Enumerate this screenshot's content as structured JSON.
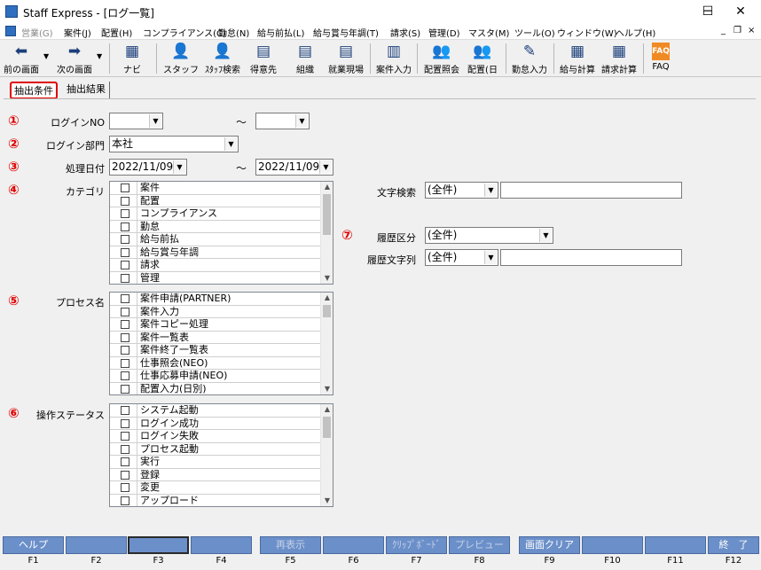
{
  "window": {
    "title": "Staff Express - [ログ一覧]",
    "min": "─",
    "max": "☐",
    "close": "✕"
  },
  "menu": [
    {
      "label": "営業(G)",
      "disabled": true
    },
    {
      "label": "案件(J)"
    },
    {
      "label": "配置(H)"
    },
    {
      "label": "コンプライアンス(C)"
    },
    {
      "label": "勤怠(N)"
    },
    {
      "label": "給与前払(L)"
    },
    {
      "label": "給与賞与年調(T)"
    },
    {
      "label": "請求(S)"
    },
    {
      "label": "管理(D)"
    },
    {
      "label": "マスタ(M)"
    },
    {
      "label": "ツール(O)"
    },
    {
      "label": "ウィンドウ(W)"
    },
    {
      "label": "ヘルプ(H)"
    }
  ],
  "mdi_buttons": {
    "min": "_",
    "restore": "❐",
    "close": "×"
  },
  "toolbar": [
    {
      "label": "前の画面",
      "icon": "back-arrow-icon"
    },
    {
      "label": "次の画面",
      "icon": "forward-arrow-icon"
    },
    {
      "label": "ナビ",
      "icon": "navi-icon"
    },
    {
      "label": "スタッフ",
      "icon": "staff-icon"
    },
    {
      "label": "ｽﾀｯﾌ検索",
      "icon": "staff-search-icon"
    },
    {
      "label": "得意先",
      "icon": "customer-icon"
    },
    {
      "label": "組織",
      "icon": "organization-icon"
    },
    {
      "label": "就業現場",
      "icon": "worksite-icon"
    },
    {
      "label": "案件入力",
      "icon": "job-entry-icon"
    },
    {
      "label": "配置照会",
      "icon": "assignment-inquiry-icon"
    },
    {
      "label": "配置(日",
      "icon": "assignment-daily-icon"
    },
    {
      "label": "勤怠入力",
      "icon": "attendance-entry-icon"
    },
    {
      "label": "給与計算",
      "icon": "payroll-calc-icon"
    },
    {
      "label": "請求計算",
      "icon": "billing-calc-icon"
    },
    {
      "label": "FAQ",
      "icon": "faq-icon"
    }
  ],
  "tabs": [
    {
      "label": "抽出条件",
      "active": true
    },
    {
      "label": "抽出結果",
      "active": false
    }
  ],
  "markers": {
    "m1": "①",
    "m2": "②",
    "m3": "③",
    "m4": "④",
    "m5": "⑤",
    "m6": "⑥",
    "m7": "⑦"
  },
  "form": {
    "login_no_label": "ログインNO",
    "login_no_from": "",
    "tilde": "～",
    "login_no_to": "",
    "dept_label": "ログイン部門",
    "dept_value": "本社",
    "date_label": "処理日付",
    "date_from": "2022/11/09",
    "date_to": "2022/11/09",
    "category_label": "カテゴリ",
    "category_items": [
      "案件",
      "配置",
      "コンプライアンス",
      "勤怠",
      "給与前払",
      "給与賞与年調",
      "請求",
      "管理"
    ],
    "process_label": "プロセス名",
    "process_items": [
      "案件申請(PARTNER)",
      "案件入力",
      "案件コピー処理",
      "案件一覧表",
      "案件終了一覧表",
      "仕事照会(NEO)",
      "仕事応募申請(NEO)",
      "配置入力(日別)"
    ],
    "status_label": "操作ステータス",
    "status_items": [
      "システム起動",
      "ログイン成功",
      "ログイン失敗",
      "プロセス起動",
      "実行",
      "登録",
      "変更",
      "アップロード"
    ],
    "text_search_label": "文字検索",
    "text_search_mode": "(全件)",
    "text_search_value": "",
    "history_type_label": "履歴区分",
    "history_type_value": "(全件)",
    "history_text_label": "履歴文字列",
    "history_text_mode": "(全件)",
    "history_text_value": ""
  },
  "fkeys": [
    {
      "label": "ヘルプ",
      "key": "F1"
    },
    {
      "label": "",
      "key": "F2"
    },
    {
      "label": "",
      "key": "F3",
      "selected": true
    },
    {
      "label": "",
      "key": "F4"
    },
    {
      "label": "再表示",
      "key": "F5",
      "disabled": true
    },
    {
      "label": "",
      "key": "F6"
    },
    {
      "label": "ｸﾘｯﾌﾟﾎﾞｰﾄﾞ",
      "key": "F7",
      "disabled": true
    },
    {
      "label": "プレビュー",
      "key": "F8",
      "disabled": true
    },
    {
      "label": "画面クリア",
      "key": "F9"
    },
    {
      "label": "",
      "key": "F10"
    },
    {
      "label": "",
      "key": "F11"
    },
    {
      "label": "終　了",
      "key": "F12"
    }
  ]
}
